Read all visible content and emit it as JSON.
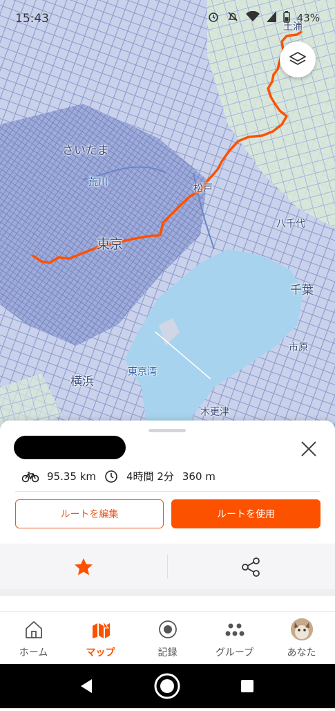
{
  "status_bar": {
    "time": "15:43",
    "battery": "43%",
    "icons": [
      "alarm-icon",
      "mute-icon",
      "wifi-icon",
      "signal-icon",
      "battery-icon"
    ]
  },
  "map": {
    "labels": {
      "saitama": "さいたま",
      "arakawa": "荒川",
      "matsudo": "松戸",
      "yachiyo": "八千代",
      "tokyo": "東京",
      "chiba": "千葉",
      "ichihara": "市原",
      "yokohama": "横浜",
      "tokyo_bay": "東京湾",
      "kisarazu": "木更津",
      "top_right": "土浦"
    },
    "route_color": "#fc5200"
  },
  "route": {
    "distance": "95.35 km",
    "duration": "4時間 2分",
    "elevation": "360 m",
    "edit_label": "ルートを編集",
    "use_label": "ルートを使用"
  },
  "nav": {
    "items": [
      {
        "label": "ホーム",
        "icon": "home-icon"
      },
      {
        "label": "マップ",
        "icon": "map-icon"
      },
      {
        "label": "記録",
        "icon": "record-icon"
      },
      {
        "label": "グループ",
        "icon": "groups-icon"
      },
      {
        "label": "あなた",
        "icon": "avatar"
      }
    ],
    "active": "マップ"
  },
  "colors": {
    "accent": "#fc5200",
    "water": "#a8d3ee",
    "roads": "#8d9bd0"
  }
}
